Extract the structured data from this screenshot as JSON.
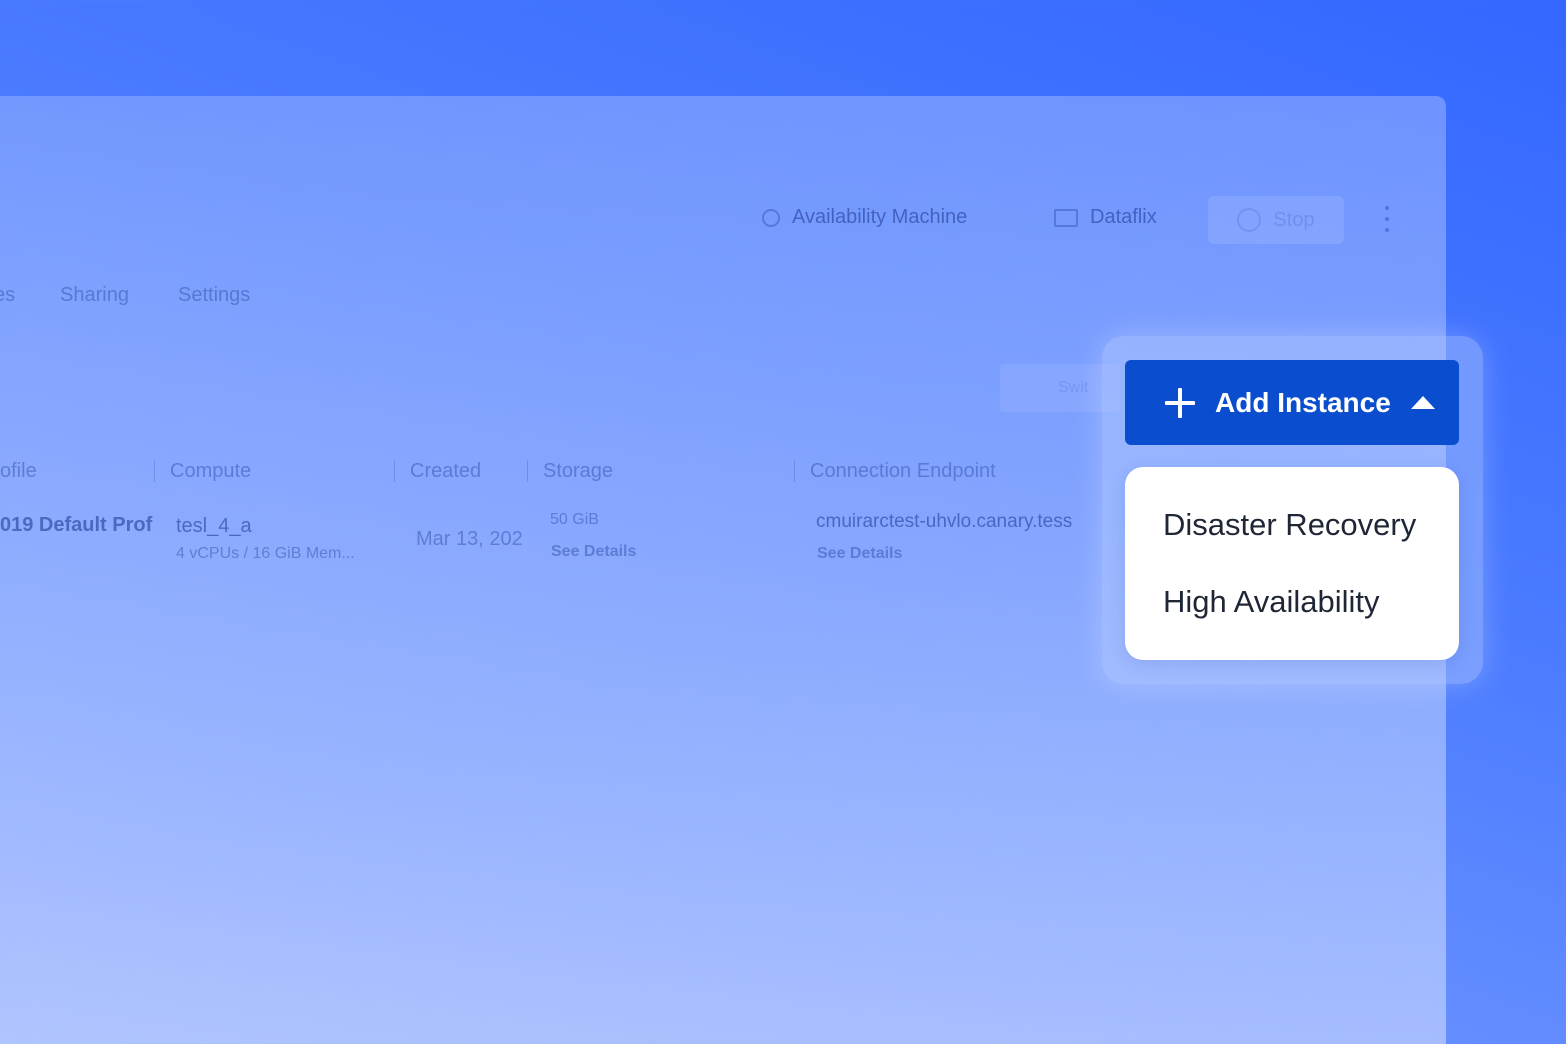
{
  "toolbar": {
    "availability_machine": "Availability Machine",
    "dataflix": "Dataflix",
    "stop": "Stop"
  },
  "tabs": {
    "partial_left": "es",
    "sharing": "Sharing",
    "settings": "Settings"
  },
  "ghost_button_label": "Swit",
  "table": {
    "headers": {
      "profile": "ofile",
      "compute": "Compute",
      "created": "Created",
      "storage": "Storage",
      "connection_endpoint": "Connection Endpoint"
    },
    "row": {
      "profile": "019 Default Prof",
      "compute_name": "tesl_4_a",
      "compute_spec": "4 vCPUs / 16 GiB Mem...",
      "created": "Mar 13, 202",
      "storage_size": "50 GiB",
      "storage_link": "See Details",
      "endpoint": "cmuirarctest-uhvlo.canary.tess",
      "endpoint_link": "See Details"
    }
  },
  "add_instance": {
    "label": "Add Instance",
    "menu": [
      "Disaster Recovery",
      "High Availability"
    ]
  },
  "colors": {
    "background": "#3367ff",
    "primary_button": "#0a4dcf",
    "menu_text": "#1f2736"
  },
  "icons": {
    "availability_machine": "clock-check-icon",
    "dataflix": "screen-play-icon",
    "stop": "stop-circle-icon",
    "more": "kebab-menu-icon",
    "add": "plus-icon",
    "dropdown": "caret-up-icon"
  }
}
